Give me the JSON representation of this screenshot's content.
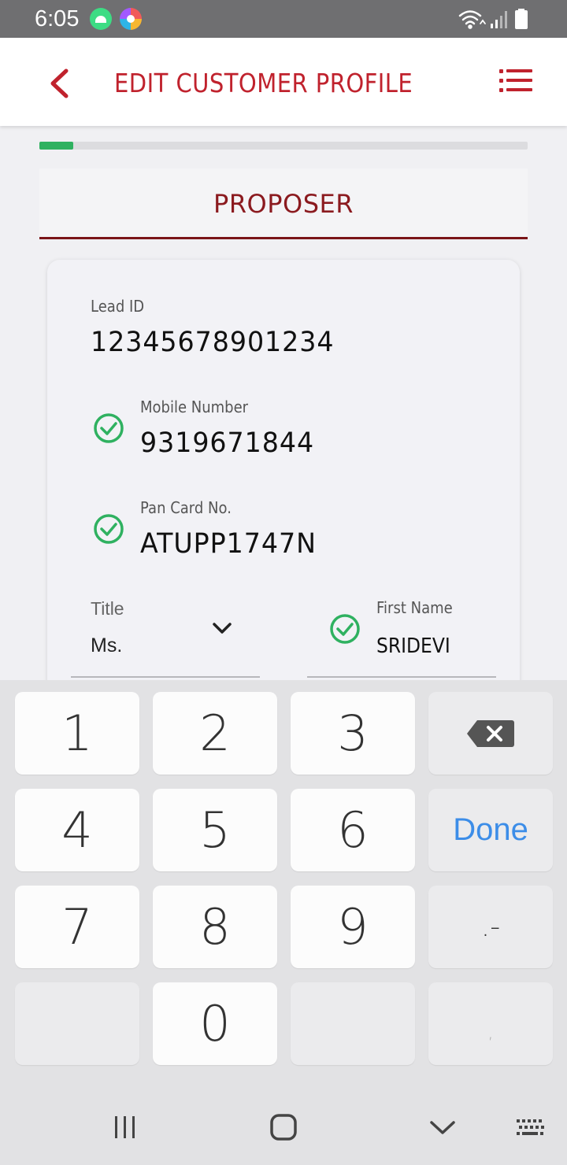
{
  "status_bar": {
    "time": "6:05",
    "icons": [
      "android-icon",
      "browser-icon",
      "wifi-icon",
      "signal-icon",
      "battery-icon"
    ]
  },
  "app_bar": {
    "title": "EDIT CUSTOMER PROFILE",
    "back_icon": "chevron-left-icon",
    "menu_icon": "list-icon",
    "accent_color": "#c0222d"
  },
  "progress": {
    "fraction": 0.07,
    "color": "#2fb160"
  },
  "section": {
    "label": "PROPOSER"
  },
  "form": {
    "lead_id": {
      "label": "Lead ID",
      "value": "12345678901234"
    },
    "mobile": {
      "label": "Mobile Number",
      "value": "9319671844",
      "verified": true
    },
    "pan": {
      "label": "Pan Card No.",
      "value": "ATUPP1747N",
      "verified": true
    },
    "title": {
      "label": "Title",
      "value": "Ms."
    },
    "first_name": {
      "label": "First Name",
      "value": "SRIDEVI",
      "verified": true
    }
  },
  "keyboard": {
    "keys": {
      "k1": "1",
      "k2": "2",
      "k3": "3",
      "k4": "4",
      "k5": "5",
      "k6": "6",
      "k7": "7",
      "k8": "8",
      "k9": "9",
      "k0": "0",
      "done": "Done",
      "symbols": ".-",
      "comma": ","
    }
  },
  "nav_bar": {
    "icons": [
      "recents-icon",
      "home-icon",
      "hide-keyboard-icon",
      "keyboard-icon"
    ]
  }
}
